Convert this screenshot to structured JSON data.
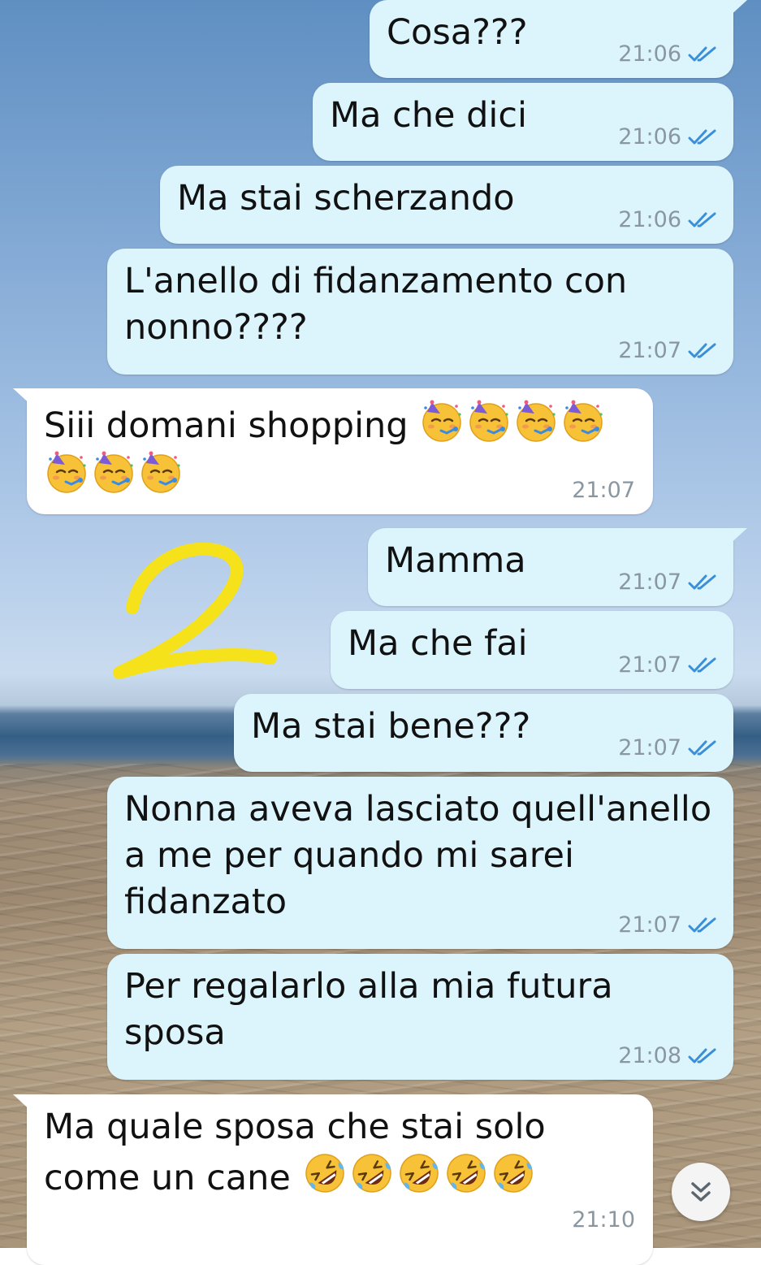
{
  "chat": {
    "messages": [
      {
        "text": "Cosa???",
        "time": "21:06",
        "direction": "out",
        "read": true
      },
      {
        "text": "Ma che dici",
        "time": "21:06",
        "direction": "out",
        "read": true
      },
      {
        "text": "Ma stai scherzando",
        "time": "21:06",
        "direction": "out",
        "read": true
      },
      {
        "text": "L'anello di fidanzamento con\nnonno????",
        "time": "21:07",
        "direction": "out",
        "read": true
      },
      {
        "text": "Siii domani shopping ",
        "time": "21:07",
        "direction": "in",
        "emoji": "partying-face",
        "emoji_count": 7
      },
      {
        "text": "Mamma",
        "time": "21:07",
        "direction": "out",
        "read": true
      },
      {
        "text": "Ma che fai",
        "time": "21:07",
        "direction": "out",
        "read": true
      },
      {
        "text": "Ma stai bene???",
        "time": "21:07",
        "direction": "out",
        "read": true
      },
      {
        "text": "Nonna aveva lasciato quell'anello\na me per quando mi sarei\nfidanzato",
        "time": "21:07",
        "direction": "out",
        "read": true
      },
      {
        "text": "Per regalarlo alla mia futura\nsposa",
        "time": "21:08",
        "direction": "out",
        "read": true
      },
      {
        "text": "Ma quale sposa che stai solo\ncome un cane ",
        "time": "21:10",
        "direction": "in",
        "emoji": "rolling-on-the-floor-laughing",
        "emoji_count": 5
      }
    ]
  },
  "annotation": {
    "text": "2",
    "color": "#f5e21b"
  },
  "colors": {
    "outgoing_bubble": "#dcf5fd",
    "incoming_bubble": "#ffffff",
    "read_ticks": "#3a8fd6",
    "timestamp": "#8a97a0"
  },
  "icons": {
    "read_receipt": "double-check-icon",
    "scroll_down": "double-chevron-down-icon"
  }
}
